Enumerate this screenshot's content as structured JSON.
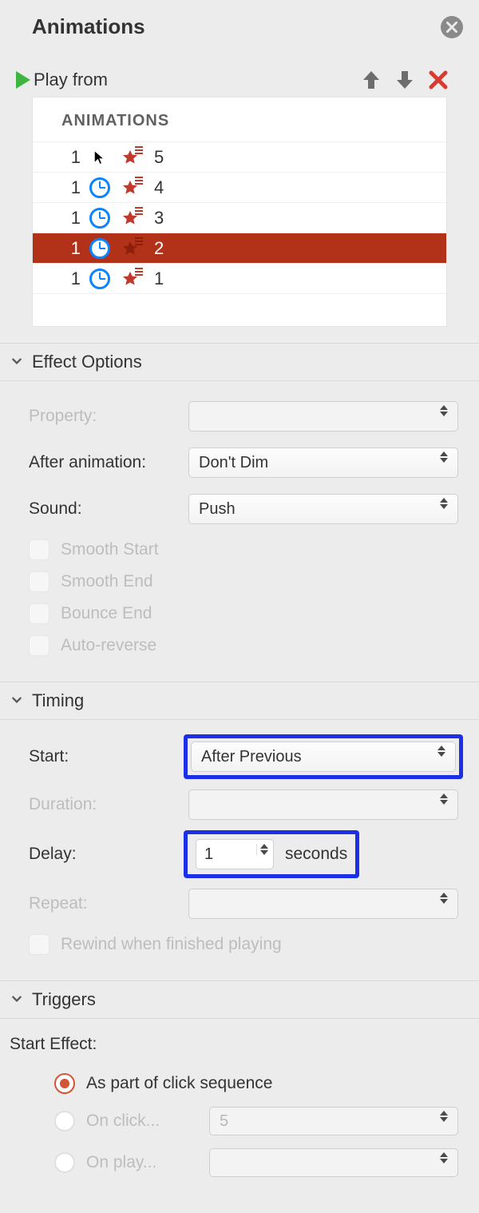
{
  "pane": {
    "title": "Animations"
  },
  "topControls": {
    "playLabel": "Play from"
  },
  "list": {
    "header": "ANIMATIONS",
    "rows": [
      {
        "order": "1",
        "trigger": "cursor",
        "label": "5",
        "selected": false
      },
      {
        "order": "1",
        "trigger": "clock",
        "label": "4",
        "selected": false
      },
      {
        "order": "1",
        "trigger": "clock",
        "label": "3",
        "selected": false
      },
      {
        "order": "1",
        "trigger": "clock",
        "label": "2",
        "selected": true
      },
      {
        "order": "1",
        "trigger": "clock",
        "label": "1",
        "selected": false
      }
    ]
  },
  "effectOptions": {
    "title": "Effect Options",
    "propertyLabel": "Property:",
    "propertyValue": "",
    "afterAnimationLabel": "After animation:",
    "afterAnimationValue": "Don't Dim",
    "soundLabel": "Sound:",
    "soundValue": "Push",
    "smoothStart": "Smooth Start",
    "smoothEnd": "Smooth End",
    "bounceEnd": "Bounce End",
    "autoReverse": "Auto-reverse"
  },
  "timing": {
    "title": "Timing",
    "startLabel": "Start:",
    "startValue": "After Previous",
    "durationLabel": "Duration:",
    "durationValue": "",
    "delayLabel": "Delay:",
    "delayValue": "1",
    "secondsLabel": "seconds",
    "repeatLabel": "Repeat:",
    "repeatValue": "",
    "rewindLabel": "Rewind when finished playing"
  },
  "triggers": {
    "title": "Triggers",
    "startEffect": "Start Effect:",
    "opt1": "As part of click sequence",
    "opt2": "On click...",
    "opt2select": "5",
    "opt3": "On play...",
    "opt3select": ""
  }
}
